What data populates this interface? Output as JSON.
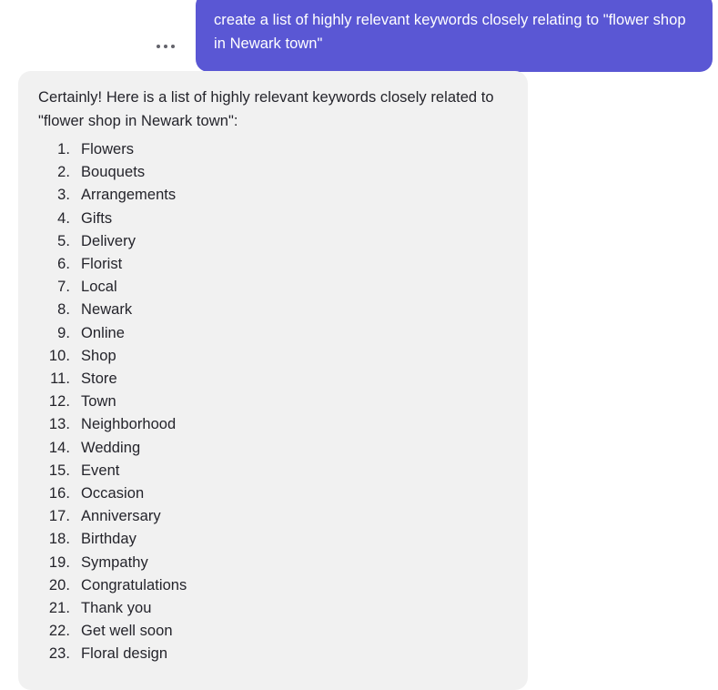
{
  "conversation": {
    "user_message": {
      "text": "create a list of highly relevant keywords closely relating to \"flower shop in Newark town\"",
      "bubble_color": "#5a57d4",
      "text_color": "#ffffff"
    },
    "more_actions": {
      "icon": "ellipsis-horizontal-icon",
      "label": "..."
    },
    "assistant_message": {
      "intro": "Certainly! Here is a list of highly relevant keywords closely related to \"flower shop in Newark town\":",
      "bubble_color": "#f1f1f1",
      "text_color": "#24242b",
      "items": [
        "Flowers",
        "Bouquets",
        "Arrangements",
        "Gifts",
        "Delivery",
        "Florist",
        "Local",
        "Newark",
        "Online",
        "Shop",
        "Store",
        "Town",
        "Neighborhood",
        "Wedding",
        "Event",
        "Occasion",
        "Anniversary",
        "Birthday",
        "Sympathy",
        "Congratulations",
        "Thank you",
        "Get well soon",
        "Floral design"
      ]
    }
  }
}
